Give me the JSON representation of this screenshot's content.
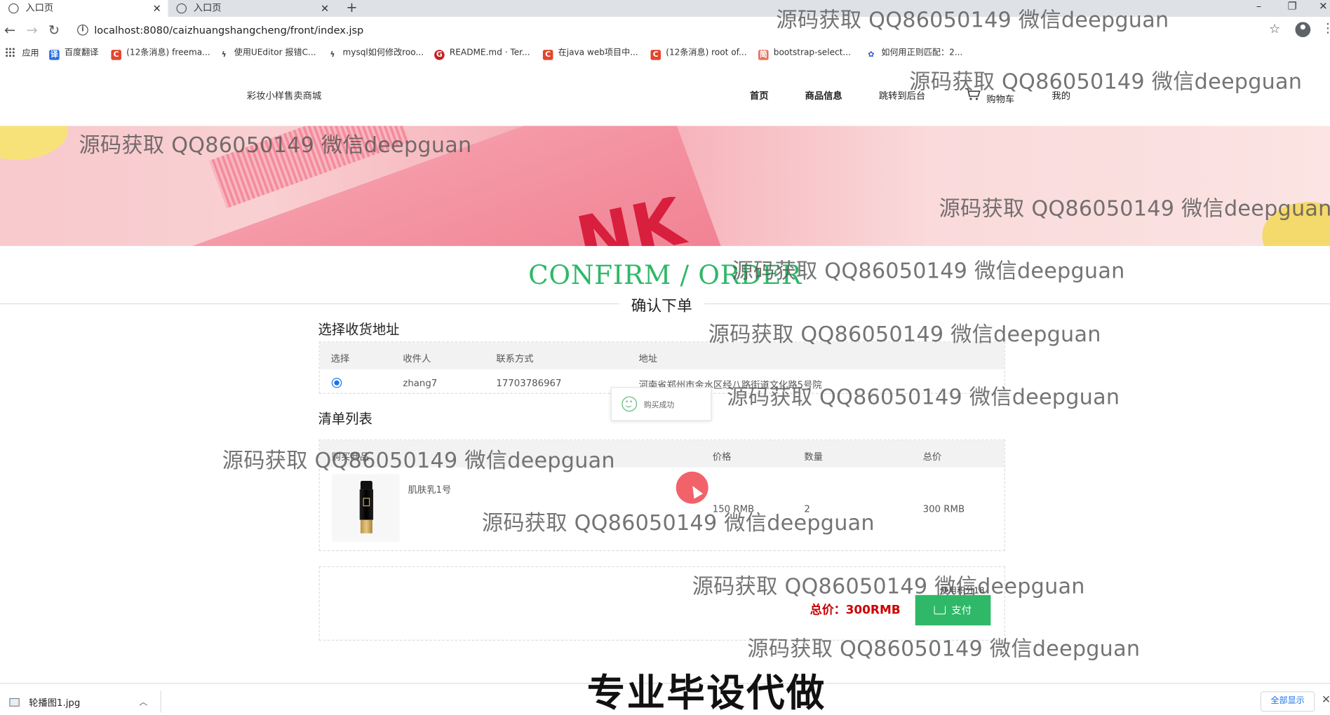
{
  "browser": {
    "tabs": [
      {
        "title": "入口页",
        "active": true
      },
      {
        "title": "入口页",
        "active": false
      }
    ],
    "new_tab": "+",
    "window_controls": {
      "minimize": "–",
      "restore": "❐",
      "close": "✕"
    },
    "url": "localhost:8080/caizhuangshangcheng/front/index.jsp",
    "bookmarks": [
      {
        "label": "应用",
        "icon": "apps-grid-icon"
      },
      {
        "label": "百度翻译",
        "icon": "translate-icon",
        "color": "#2a6fe0"
      },
      {
        "label": "(12条消息) freema...",
        "icon": "csdn-icon",
        "color": "#e2462c"
      },
      {
        "label": "使用UEditor 报错C...",
        "icon": "bird-icon",
        "color": "#444444"
      },
      {
        "label": "mysql如何修改roo...",
        "icon": "bird-icon",
        "color": "#444444"
      },
      {
        "label": "README.md · Ter...",
        "icon": "gitee-icon",
        "color": "#c71d23"
      },
      {
        "label": "在java web项目中...",
        "icon": "csdn-icon",
        "color": "#e2462c"
      },
      {
        "label": "(12条消息) root of...",
        "icon": "csdn-icon",
        "color": "#e2462c"
      },
      {
        "label": "bootstrap-select...",
        "icon": "jianshu-icon",
        "color": "#ea6f5a"
      },
      {
        "label": "如何用正则匹配：2...",
        "icon": "paw-icon",
        "color": "#3050c8"
      }
    ]
  },
  "site": {
    "title": "彩妆小样售卖商城",
    "nav": [
      {
        "label": "首页",
        "bold": true
      },
      {
        "label": "商品信息",
        "bold": true
      },
      {
        "label": "跳转到后台",
        "bold": false
      },
      {
        "label": "购物车",
        "bold": false
      },
      {
        "label": "我的",
        "bold": false
      }
    ]
  },
  "banner": {
    "letters": "NK"
  },
  "order": {
    "title_en": "CONFIRM / ORDER",
    "title_cn": "确认下单",
    "address_section": "选择收货地址",
    "address_headers": [
      "选择",
      "收件人",
      "联系方式",
      "地址"
    ],
    "address_rows": [
      {
        "selected": true,
        "name": "zhang7",
        "phone": "17703786967",
        "address": "河南省郑州市金水区经八路街道文化路5号院"
      }
    ],
    "list_section": "清单列表",
    "list_headers": [
      "购买商品",
      "价格",
      "数量",
      "总价"
    ],
    "items": [
      {
        "name": "肌肤乳1号",
        "price": "150 RMB",
        "qty": "2",
        "total": "300 RMB"
      }
    ],
    "points": "使用积分18",
    "total_label": "总价：300RMB",
    "pay_label": "支付"
  },
  "toast": {
    "text": "购买成功"
  },
  "downloads": {
    "file": "轮播图1.jpg",
    "show_all": "全部显示",
    "close": "✕"
  },
  "overlay": {
    "watermark": "源码获取 QQ86050149 微信deepguan",
    "ad": "专业毕设代做"
  }
}
